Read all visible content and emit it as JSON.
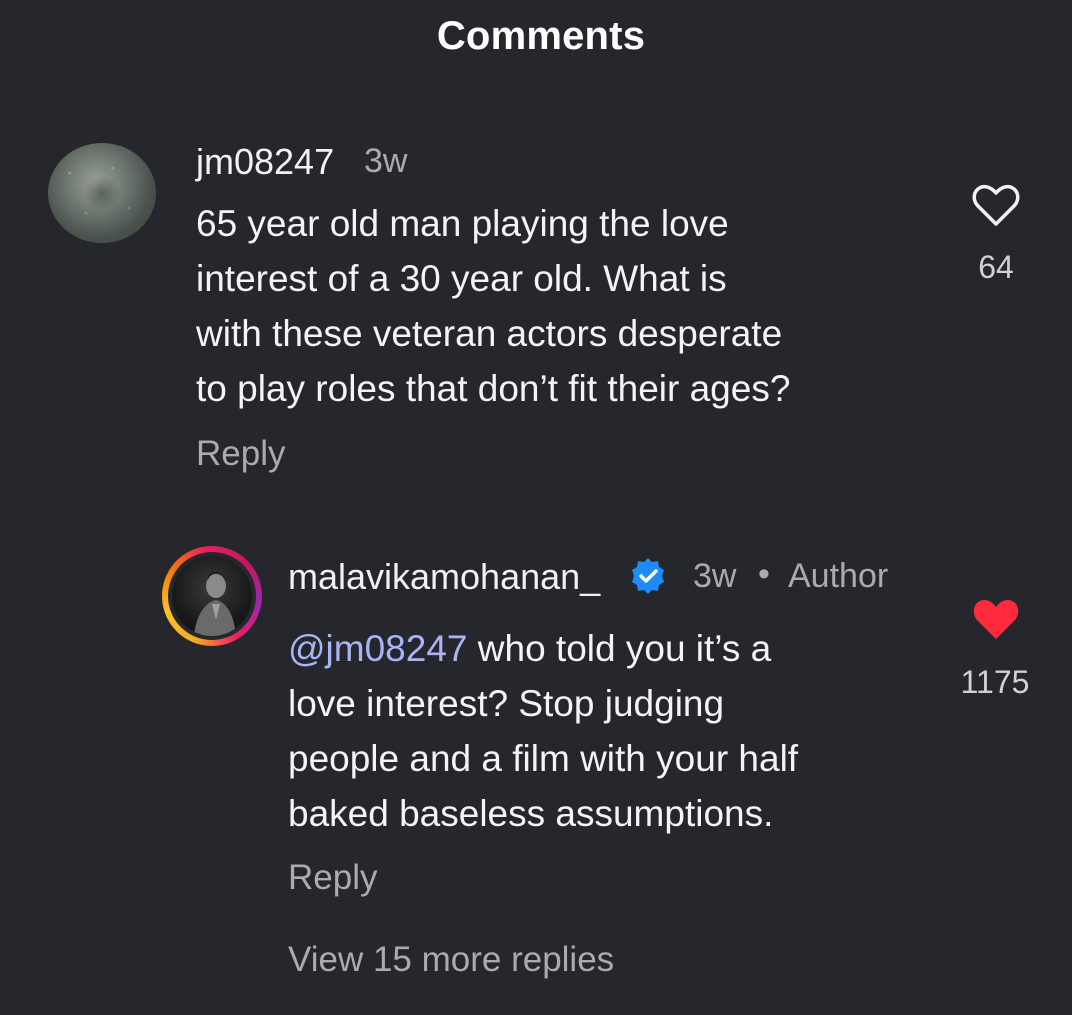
{
  "header": {
    "title": "Comments"
  },
  "comments": [
    {
      "username": "jm08247",
      "time": "3w",
      "text": "65 year old man playing the love interest of a 30 year old. What is with these veteran actors desperate to play roles that don’t fit their ages?",
      "text_lines": [
        "65 year old man playing the love",
        "interest of a 30 year old. What is",
        "with these veteran actors desperate",
        "to play roles that don’t fit their ages?"
      ],
      "reply_label": "Reply",
      "likes": "64",
      "liked": false,
      "heart_icon": "heart-outline-icon"
    },
    {
      "username": "malavikamohanan_",
      "verified": true,
      "time": "3w",
      "separator": "•",
      "badge": "Author",
      "mention": "@jm08247",
      "text_lines": [
        " who told you it’s a",
        "love interest? Stop judging",
        "people and a film with your half",
        "baked baseless assumptions."
      ],
      "reply_label": "Reply",
      "likes": "1175",
      "liked": true,
      "heart_icon": "heart-filled-icon",
      "heart_color": "#ff2a3d"
    }
  ],
  "view_more_replies": "View 15 more replies",
  "colors": {
    "background": "#25272c",
    "mention": "#a9b4f5",
    "verified": "#1d8cf8",
    "muted": "#a8abb0"
  }
}
